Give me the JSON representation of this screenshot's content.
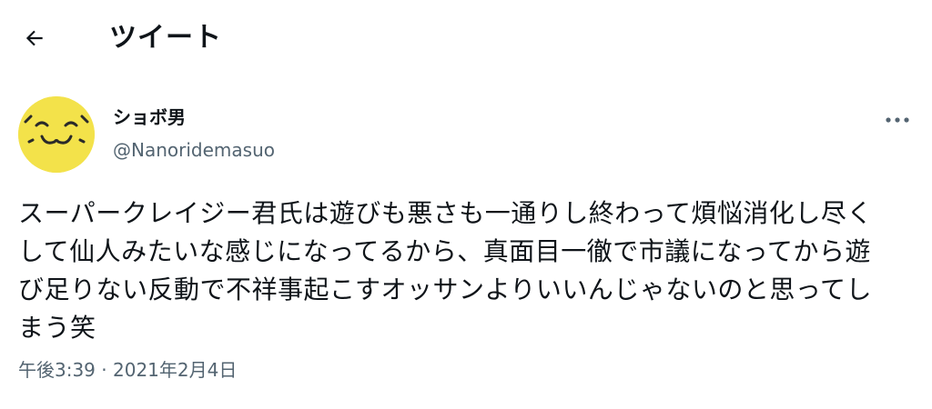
{
  "header": {
    "back_icon": "arrow-left-icon",
    "title": "ツイート"
  },
  "author": {
    "avatar_icon": "smiley-face-avatar",
    "avatar_color": "#f3e24a",
    "display_name": "ショボ男",
    "handle": "@Nanoridemasuo",
    "more_icon": "more-horizontal-icon"
  },
  "tweet": {
    "text": "スーパークレイジー君氏は遊びも悪さも一通りし終わって煩悩消化し尽く\nして仙人みたいな感じになってるから、真面目一徹で市議になってから遊\nび足りない反動で不祥事起こすオッサンよりいいんじゃないのと思ってし\nまう笑",
    "time": "午後3:39",
    "separator": "·",
    "date": "2021年2月4日"
  }
}
